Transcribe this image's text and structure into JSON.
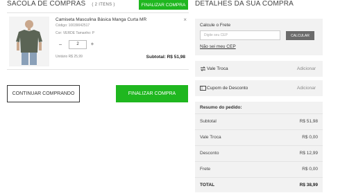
{
  "cart": {
    "title": "SACOLA DE COMPRAS",
    "count": "( 2 ITENS )",
    "finalize_top_label": "FINALIZAR COMPRA",
    "item": {
      "name": "Camiseta Masculina Básica Manga Curta MR",
      "code": "Código: 10039042517",
      "attributes": "Cor: VERDE Tamanho: P",
      "qty_minus": "−",
      "quantity": "2",
      "qty_plus": "+",
      "unit_price": "Unitário R$ 25,99",
      "subtotal": "Subtotal: R$ 51,98",
      "remove": "×",
      "shirt_color": "#5b6455"
    },
    "continue_label": "CONTINUAR COMPRANDO",
    "finalize_label": "FINALIZAR COMPRA"
  },
  "summary": {
    "title": "DETALHES DA SUA COMPRA",
    "shipping": {
      "label": "Calcule o Frete",
      "placeholder": "Digite seu CEP",
      "button": "CALCULAR",
      "link": "Não sei meu CEP"
    },
    "vale_troca": {
      "label": "Vale Troca",
      "action": "Adicionar",
      "icon": "exchange-icon"
    },
    "cupom": {
      "label": "Cupom de Desconto",
      "action": "Adicionar",
      "icon": "ticket-icon"
    },
    "resumo": {
      "title": "Resumo do pedido:",
      "rows": [
        {
          "label": "Subtotal",
          "value": "R$ 51,98"
        },
        {
          "label": "Vale Troca",
          "value": "R$ 0,00"
        },
        {
          "label": "Desconto",
          "value": "R$ 12,99"
        },
        {
          "label": "Frete",
          "value": "R$ 0,00"
        }
      ],
      "total_label": "TOTAL",
      "total_value": "R$ 38,99"
    }
  },
  "colors": {
    "accent_green": "#1fb71f",
    "panel_gray": "#f2f2f2",
    "button_gray": "#6b6b6b"
  }
}
